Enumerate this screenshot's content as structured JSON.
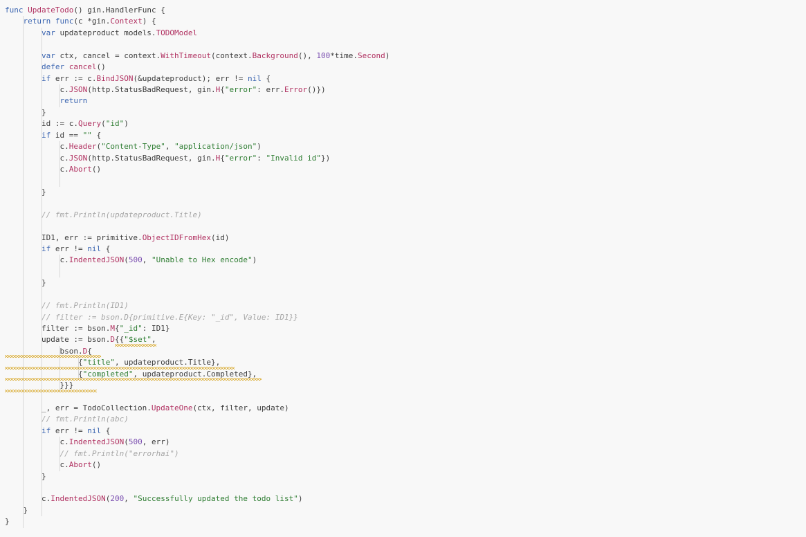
{
  "editor": {
    "background": "#f8f8f8",
    "language": "Go",
    "colors": {
      "keyword": "#3a64b0",
      "function": "#b03060",
      "string": "#2e7d32",
      "number": "#7b4fb0",
      "comment": "#a6a6a6",
      "plain": "#3c3c3c",
      "warning_squiggle": "#d6a21a"
    },
    "lines": [
      [
        {
          "t": "k",
          "v": "func"
        },
        {
          "t": "p",
          "v": " "
        },
        {
          "t": "f",
          "v": "UpdateTodo"
        },
        {
          "t": "p",
          "v": "() gin.HandlerFunc {"
        }
      ],
      [
        {
          "t": "p",
          "v": "    "
        },
        {
          "t": "k",
          "v": "return"
        },
        {
          "t": "p",
          "v": " "
        },
        {
          "t": "k",
          "v": "func"
        },
        {
          "t": "p",
          "v": "(c *gin."
        },
        {
          "t": "f",
          "v": "Context"
        },
        {
          "t": "p",
          "v": ") {"
        }
      ],
      [
        {
          "t": "p",
          "v": "        "
        },
        {
          "t": "k",
          "v": "var"
        },
        {
          "t": "p",
          "v": " updateproduct models."
        },
        {
          "t": "f",
          "v": "TODOModel"
        }
      ],
      [],
      [
        {
          "t": "p",
          "v": "        "
        },
        {
          "t": "k",
          "v": "var"
        },
        {
          "t": "p",
          "v": " ctx, cancel = context."
        },
        {
          "t": "f",
          "v": "WithTimeout"
        },
        {
          "t": "p",
          "v": "(context."
        },
        {
          "t": "f",
          "v": "Background"
        },
        {
          "t": "p",
          "v": "(), "
        },
        {
          "t": "n",
          "v": "100"
        },
        {
          "t": "p",
          "v": "*time."
        },
        {
          "t": "f",
          "v": "Second"
        },
        {
          "t": "p",
          "v": ")"
        }
      ],
      [
        {
          "t": "p",
          "v": "        "
        },
        {
          "t": "k",
          "v": "defer"
        },
        {
          "t": "p",
          "v": " "
        },
        {
          "t": "f",
          "v": "cancel"
        },
        {
          "t": "p",
          "v": "()"
        }
      ],
      [
        {
          "t": "p",
          "v": "        "
        },
        {
          "t": "k",
          "v": "if"
        },
        {
          "t": "p",
          "v": " err := c."
        },
        {
          "t": "f",
          "v": "BindJSON"
        },
        {
          "t": "p",
          "v": "(&updateproduct); err != "
        },
        {
          "t": "k",
          "v": "nil"
        },
        {
          "t": "p",
          "v": " {"
        }
      ],
      [
        {
          "t": "p",
          "v": "            c."
        },
        {
          "t": "f",
          "v": "JSON"
        },
        {
          "t": "p",
          "v": "(http.StatusBadRequest, gin."
        },
        {
          "t": "f",
          "v": "H"
        },
        {
          "t": "p",
          "v": "{"
        },
        {
          "t": "s",
          "v": "\"error\""
        },
        {
          "t": "p",
          "v": ": err."
        },
        {
          "t": "f",
          "v": "Error"
        },
        {
          "t": "p",
          "v": "()})"
        }
      ],
      [
        {
          "t": "p",
          "v": "            "
        },
        {
          "t": "k",
          "v": "return"
        }
      ],
      [
        {
          "t": "p",
          "v": "        }"
        }
      ],
      [
        {
          "t": "p",
          "v": "        id := c."
        },
        {
          "t": "f",
          "v": "Query"
        },
        {
          "t": "p",
          "v": "("
        },
        {
          "t": "s",
          "v": "\"id\""
        },
        {
          "t": "p",
          "v": ")"
        }
      ],
      [
        {
          "t": "p",
          "v": "        "
        },
        {
          "t": "k",
          "v": "if"
        },
        {
          "t": "p",
          "v": " id == "
        },
        {
          "t": "s",
          "v": "\"\""
        },
        {
          "t": "p",
          "v": " {"
        }
      ],
      [
        {
          "t": "p",
          "v": "            c."
        },
        {
          "t": "f",
          "v": "Header"
        },
        {
          "t": "p",
          "v": "("
        },
        {
          "t": "s",
          "v": "\"Content-Type\""
        },
        {
          "t": "p",
          "v": ", "
        },
        {
          "t": "s",
          "v": "\"application/json\""
        },
        {
          "t": "p",
          "v": ")"
        }
      ],
      [
        {
          "t": "p",
          "v": "            c."
        },
        {
          "t": "f",
          "v": "JSON"
        },
        {
          "t": "p",
          "v": "(http.StatusBadRequest, gin."
        },
        {
          "t": "f",
          "v": "H"
        },
        {
          "t": "p",
          "v": "{"
        },
        {
          "t": "s",
          "v": "\"error\""
        },
        {
          "t": "p",
          "v": ": "
        },
        {
          "t": "s",
          "v": "\"Invalid id\""
        },
        {
          "t": "p",
          "v": "})"
        }
      ],
      [
        {
          "t": "p",
          "v": "            c."
        },
        {
          "t": "f",
          "v": "Abort"
        },
        {
          "t": "p",
          "v": "()"
        }
      ],
      [],
      [
        {
          "t": "p",
          "v": "        }"
        }
      ],
      [],
      [
        {
          "t": "p",
          "v": "        "
        },
        {
          "t": "c",
          "v": "// fmt.Println(updateproduct.Title)"
        }
      ],
      [],
      [
        {
          "t": "p",
          "v": "        ID1, err := primitive."
        },
        {
          "t": "f",
          "v": "ObjectIDFromHex"
        },
        {
          "t": "p",
          "v": "(id)"
        }
      ],
      [
        {
          "t": "p",
          "v": "        "
        },
        {
          "t": "k",
          "v": "if"
        },
        {
          "t": "p",
          "v": " err != "
        },
        {
          "t": "k",
          "v": "nil"
        },
        {
          "t": "p",
          "v": " {"
        }
      ],
      [
        {
          "t": "p",
          "v": "            c."
        },
        {
          "t": "f",
          "v": "IndentedJSON"
        },
        {
          "t": "p",
          "v": "("
        },
        {
          "t": "n",
          "v": "500"
        },
        {
          "t": "p",
          "v": ", "
        },
        {
          "t": "s",
          "v": "\"Unable to Hex encode\""
        },
        {
          "t": "p",
          "v": ")"
        }
      ],
      [],
      [
        {
          "t": "p",
          "v": "        }"
        }
      ],
      [],
      [
        {
          "t": "p",
          "v": "        "
        },
        {
          "t": "c",
          "v": "// fmt.Println(ID1)"
        }
      ],
      [
        {
          "t": "p",
          "v": "        "
        },
        {
          "t": "c",
          "v": "// filter := bson.D{primitive.E{Key: \"_id\", Value: ID1}}"
        }
      ],
      [
        {
          "t": "p",
          "v": "        filter := bson."
        },
        {
          "t": "f",
          "v": "M"
        },
        {
          "t": "p",
          "v": "{"
        },
        {
          "t": "s",
          "v": "\"_id\""
        },
        {
          "t": "p",
          "v": ": ID1}"
        }
      ],
      [
        {
          "t": "p",
          "v": "        update := bson."
        },
        {
          "t": "f",
          "v": "D"
        },
        {
          "t": "p",
          "v": "{{"
        },
        {
          "t": "s",
          "v": "\"$set\""
        },
        {
          "t": "p",
          "v": ","
        }
      ],
      [
        {
          "t": "p",
          "v": "            bson."
        },
        {
          "t": "f",
          "v": "D"
        },
        {
          "t": "p",
          "v": "{"
        }
      ],
      [
        {
          "t": "p",
          "v": "                {"
        },
        {
          "t": "s",
          "v": "\"title\""
        },
        {
          "t": "p",
          "v": ", updateproduct.Title},"
        }
      ],
      [
        {
          "t": "p",
          "v": "                {"
        },
        {
          "t": "s",
          "v": "\"completed\""
        },
        {
          "t": "p",
          "v": ", updateproduct.Completed},"
        }
      ],
      [
        {
          "t": "p",
          "v": "            }}}"
        }
      ],
      [],
      [
        {
          "t": "p",
          "v": "        _, err = TodoCollection."
        },
        {
          "t": "f",
          "v": "UpdateOne"
        },
        {
          "t": "p",
          "v": "(ctx, filter, update)"
        }
      ],
      [
        {
          "t": "p",
          "v": "        "
        },
        {
          "t": "c",
          "v": "// fmt.Println(abc)"
        }
      ],
      [
        {
          "t": "p",
          "v": "        "
        },
        {
          "t": "k",
          "v": "if"
        },
        {
          "t": "p",
          "v": " err != "
        },
        {
          "t": "k",
          "v": "nil"
        },
        {
          "t": "p",
          "v": " {"
        }
      ],
      [
        {
          "t": "p",
          "v": "            c."
        },
        {
          "t": "f",
          "v": "IndentedJSON"
        },
        {
          "t": "p",
          "v": "("
        },
        {
          "t": "n",
          "v": "500"
        },
        {
          "t": "p",
          "v": ", err)"
        }
      ],
      [
        {
          "t": "p",
          "v": "            "
        },
        {
          "t": "c",
          "v": "// fmt.Println(\"errorhai\")"
        }
      ],
      [
        {
          "t": "p",
          "v": "            c."
        },
        {
          "t": "f",
          "v": "Abort"
        },
        {
          "t": "p",
          "v": "()"
        }
      ],
      [
        {
          "t": "p",
          "v": "        }"
        }
      ],
      [],
      [
        {
          "t": "p",
          "v": "        c."
        },
        {
          "t": "f",
          "v": "IndentedJSON"
        },
        {
          "t": "p",
          "v": "("
        },
        {
          "t": "n",
          "v": "200"
        },
        {
          "t": "p",
          "v": ", "
        },
        {
          "t": "s",
          "v": "\"Successfully updated the todo list\""
        },
        {
          "t": "p",
          "v": ")"
        }
      ],
      [
        {
          "t": "p",
          "v": "    }"
        }
      ],
      [
        {
          "t": "p",
          "v": "}"
        }
      ]
    ]
  }
}
